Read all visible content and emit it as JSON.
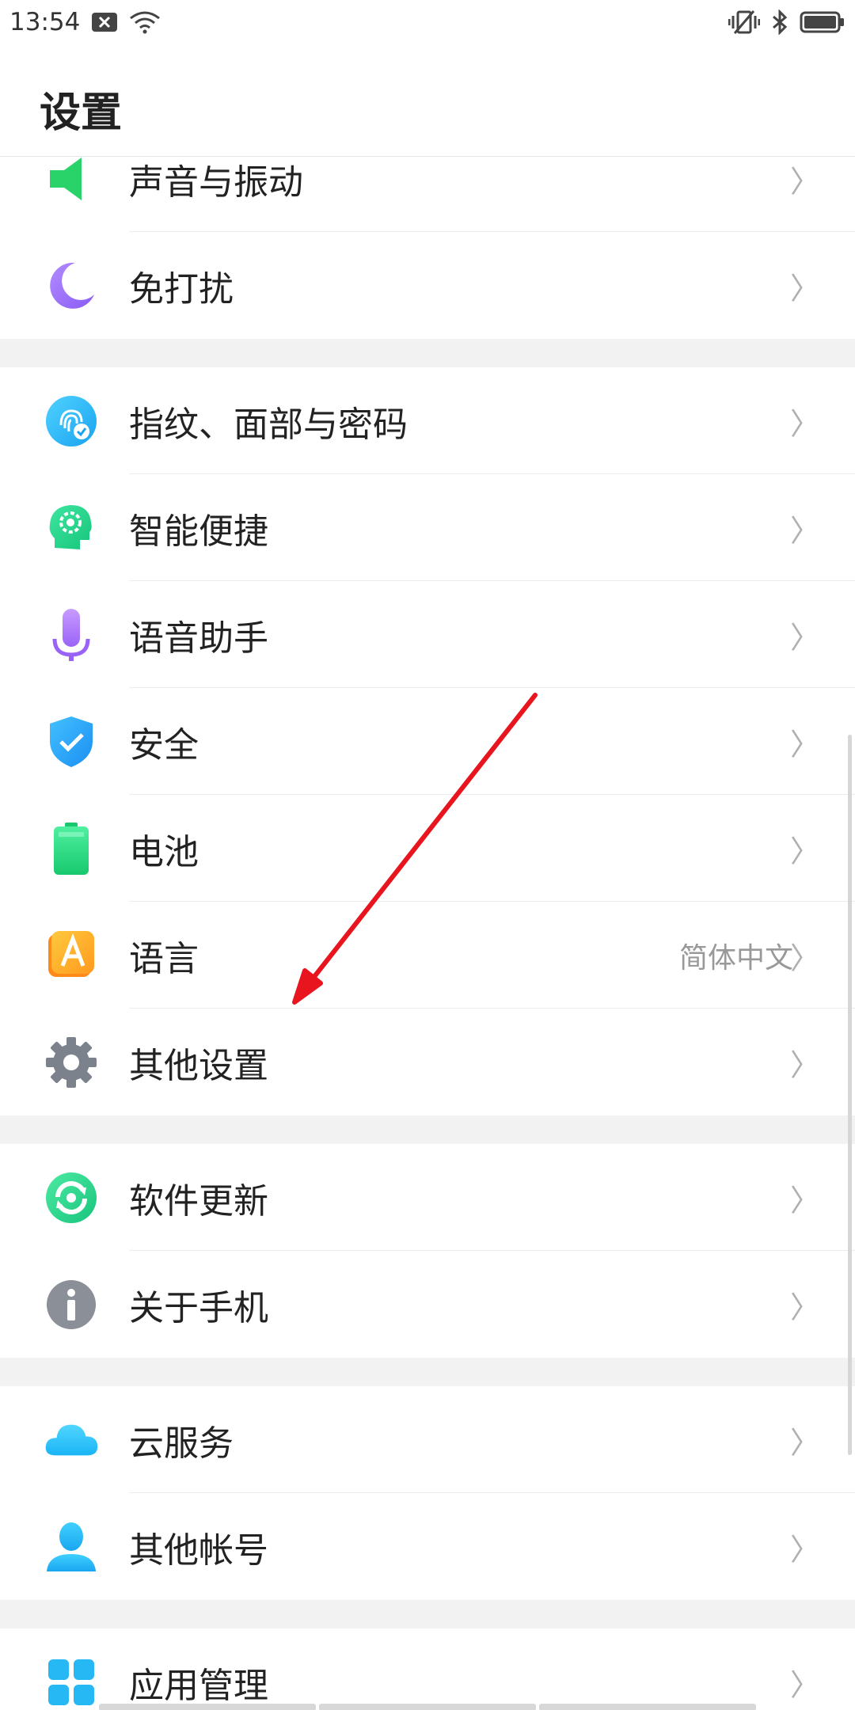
{
  "status_bar": {
    "time": "13:54",
    "icons": [
      "notification-x-icon",
      "wifi-icon",
      "vibrate-icon",
      "bluetooth-icon",
      "battery-icon"
    ]
  },
  "header": {
    "title": "设置"
  },
  "groups": [
    {
      "items": [
        {
          "label": "声音与振动",
          "icon": "sound-icon"
        },
        {
          "label": "免打扰",
          "icon": "moon-icon"
        }
      ]
    },
    {
      "items": [
        {
          "label": "指纹、面部与密码",
          "icon": "fingerprint-icon"
        },
        {
          "label": "智能便捷",
          "icon": "smart-head-icon"
        },
        {
          "label": "语音助手",
          "icon": "microphone-icon"
        },
        {
          "label": "安全",
          "icon": "shield-icon"
        },
        {
          "label": "电池",
          "icon": "battery-icon"
        },
        {
          "label": "语言",
          "icon": "language-icon",
          "value": "简体中文"
        },
        {
          "label": "其他设置",
          "icon": "gear-icon"
        }
      ]
    },
    {
      "items": [
        {
          "label": "软件更新",
          "icon": "update-icon"
        },
        {
          "label": "关于手机",
          "icon": "info-icon"
        }
      ]
    },
    {
      "items": [
        {
          "label": "云服务",
          "icon": "cloud-icon"
        },
        {
          "label": "其他帐号",
          "icon": "person-icon"
        }
      ]
    },
    {
      "items": [
        {
          "label": "应用管理",
          "icon": "apps-grid-icon"
        }
      ]
    }
  ],
  "chevron": "〉",
  "colors": {
    "annotation_arrow": "#e8141e",
    "group_gap": "#f2f2f2"
  }
}
